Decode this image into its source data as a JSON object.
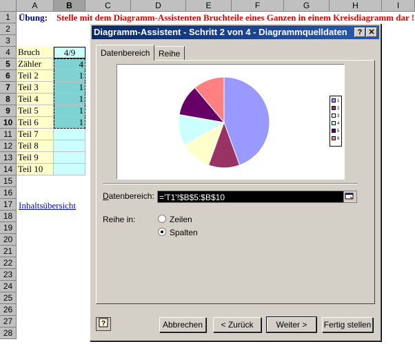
{
  "spreadsheet": {
    "columns": [
      "A",
      "B",
      "C",
      "D",
      "E",
      "F",
      "G",
      "H",
      "I"
    ],
    "rows": [
      "1",
      "2",
      "3",
      "4",
      "5",
      "6",
      "7",
      "8",
      "9",
      "10",
      "11",
      "12",
      "13",
      "14",
      "15",
      "16",
      "17",
      "18",
      "19",
      "20",
      "21",
      "22",
      "23",
      "24",
      "25",
      "26",
      "27",
      "28"
    ],
    "row1_label": "Übung:",
    "row1_title": "Stelle mit dem Diagramm-Assistenten Bruchteile eines Ganzen in einem Kreisdiagramm dar !",
    "table": [
      {
        "label": "Bruch",
        "value": "4/9"
      },
      {
        "label": "Zähler",
        "value": "4"
      },
      {
        "label": "Teil 2",
        "value": "1"
      },
      {
        "label": "Teil 3",
        "value": "1"
      },
      {
        "label": "Teil 4",
        "value": "1"
      },
      {
        "label": "Teil 5",
        "value": "1"
      },
      {
        "label": "Teil 6",
        "value": "1"
      },
      {
        "label": "Teil 7",
        "value": ""
      },
      {
        "label": "Teil 8",
        "value": ""
      },
      {
        "label": "Teil 9",
        "value": ""
      },
      {
        "label": "Teil 10",
        "value": ""
      }
    ],
    "link": "Inhaltsübersicht"
  },
  "dialog": {
    "title": "Diagramm-Assistent - Schritt 2 von 4 - Diagrammquelldaten",
    "help_btn": "?",
    "close_btn": "✕",
    "tabs": [
      "Datenbereich",
      "Reihe"
    ],
    "range_label": "Datenbereich:",
    "range_value": "='T1'!$B$5:$B$10",
    "series_in_label": "Reihe in:",
    "option_rows": "Zeilen",
    "option_cols": "Spalten",
    "selected_option": "Spalten",
    "buttons": {
      "cancel": "Abbrechen",
      "back": "< Zurück",
      "next": "Weiter >",
      "finish": "Fertig stellen"
    }
  },
  "chart_data": {
    "type": "pie",
    "categories": [
      "1",
      "2",
      "3",
      "4",
      "5",
      "6"
    ],
    "values": [
      4,
      1,
      1,
      1,
      1,
      1
    ],
    "colors": [
      "#9999ff",
      "#993366",
      "#ffffcc",
      "#ccffff",
      "#660066",
      "#ff8080"
    ]
  }
}
